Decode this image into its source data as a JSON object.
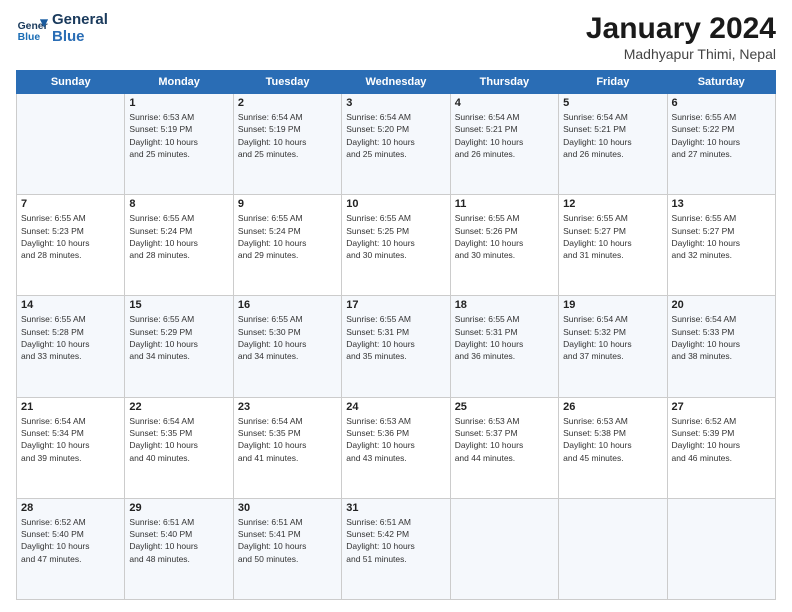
{
  "logo": {
    "line1": "General",
    "line2": "Blue"
  },
  "title": "January 2024",
  "location": "Madhyapur Thimi, Nepal",
  "days_of_week": [
    "Sunday",
    "Monday",
    "Tuesday",
    "Wednesday",
    "Thursday",
    "Friday",
    "Saturday"
  ],
  "weeks": [
    [
      {
        "num": "",
        "info": ""
      },
      {
        "num": "1",
        "info": "Sunrise: 6:53 AM\nSunset: 5:19 PM\nDaylight: 10 hours\nand 25 minutes."
      },
      {
        "num": "2",
        "info": "Sunrise: 6:54 AM\nSunset: 5:19 PM\nDaylight: 10 hours\nand 25 minutes."
      },
      {
        "num": "3",
        "info": "Sunrise: 6:54 AM\nSunset: 5:20 PM\nDaylight: 10 hours\nand 25 minutes."
      },
      {
        "num": "4",
        "info": "Sunrise: 6:54 AM\nSunset: 5:21 PM\nDaylight: 10 hours\nand 26 minutes."
      },
      {
        "num": "5",
        "info": "Sunrise: 6:54 AM\nSunset: 5:21 PM\nDaylight: 10 hours\nand 26 minutes."
      },
      {
        "num": "6",
        "info": "Sunrise: 6:55 AM\nSunset: 5:22 PM\nDaylight: 10 hours\nand 27 minutes."
      }
    ],
    [
      {
        "num": "7",
        "info": "Sunrise: 6:55 AM\nSunset: 5:23 PM\nDaylight: 10 hours\nand 28 minutes."
      },
      {
        "num": "8",
        "info": "Sunrise: 6:55 AM\nSunset: 5:24 PM\nDaylight: 10 hours\nand 28 minutes."
      },
      {
        "num": "9",
        "info": "Sunrise: 6:55 AM\nSunset: 5:24 PM\nDaylight: 10 hours\nand 29 minutes."
      },
      {
        "num": "10",
        "info": "Sunrise: 6:55 AM\nSunset: 5:25 PM\nDaylight: 10 hours\nand 30 minutes."
      },
      {
        "num": "11",
        "info": "Sunrise: 6:55 AM\nSunset: 5:26 PM\nDaylight: 10 hours\nand 30 minutes."
      },
      {
        "num": "12",
        "info": "Sunrise: 6:55 AM\nSunset: 5:27 PM\nDaylight: 10 hours\nand 31 minutes."
      },
      {
        "num": "13",
        "info": "Sunrise: 6:55 AM\nSunset: 5:27 PM\nDaylight: 10 hours\nand 32 minutes."
      }
    ],
    [
      {
        "num": "14",
        "info": "Sunrise: 6:55 AM\nSunset: 5:28 PM\nDaylight: 10 hours\nand 33 minutes."
      },
      {
        "num": "15",
        "info": "Sunrise: 6:55 AM\nSunset: 5:29 PM\nDaylight: 10 hours\nand 34 minutes."
      },
      {
        "num": "16",
        "info": "Sunrise: 6:55 AM\nSunset: 5:30 PM\nDaylight: 10 hours\nand 34 minutes."
      },
      {
        "num": "17",
        "info": "Sunrise: 6:55 AM\nSunset: 5:31 PM\nDaylight: 10 hours\nand 35 minutes."
      },
      {
        "num": "18",
        "info": "Sunrise: 6:55 AM\nSunset: 5:31 PM\nDaylight: 10 hours\nand 36 minutes."
      },
      {
        "num": "19",
        "info": "Sunrise: 6:54 AM\nSunset: 5:32 PM\nDaylight: 10 hours\nand 37 minutes."
      },
      {
        "num": "20",
        "info": "Sunrise: 6:54 AM\nSunset: 5:33 PM\nDaylight: 10 hours\nand 38 minutes."
      }
    ],
    [
      {
        "num": "21",
        "info": "Sunrise: 6:54 AM\nSunset: 5:34 PM\nDaylight: 10 hours\nand 39 minutes."
      },
      {
        "num": "22",
        "info": "Sunrise: 6:54 AM\nSunset: 5:35 PM\nDaylight: 10 hours\nand 40 minutes."
      },
      {
        "num": "23",
        "info": "Sunrise: 6:54 AM\nSunset: 5:35 PM\nDaylight: 10 hours\nand 41 minutes."
      },
      {
        "num": "24",
        "info": "Sunrise: 6:53 AM\nSunset: 5:36 PM\nDaylight: 10 hours\nand 43 minutes."
      },
      {
        "num": "25",
        "info": "Sunrise: 6:53 AM\nSunset: 5:37 PM\nDaylight: 10 hours\nand 44 minutes."
      },
      {
        "num": "26",
        "info": "Sunrise: 6:53 AM\nSunset: 5:38 PM\nDaylight: 10 hours\nand 45 minutes."
      },
      {
        "num": "27",
        "info": "Sunrise: 6:52 AM\nSunset: 5:39 PM\nDaylight: 10 hours\nand 46 minutes."
      }
    ],
    [
      {
        "num": "28",
        "info": "Sunrise: 6:52 AM\nSunset: 5:40 PM\nDaylight: 10 hours\nand 47 minutes."
      },
      {
        "num": "29",
        "info": "Sunrise: 6:51 AM\nSunset: 5:40 PM\nDaylight: 10 hours\nand 48 minutes."
      },
      {
        "num": "30",
        "info": "Sunrise: 6:51 AM\nSunset: 5:41 PM\nDaylight: 10 hours\nand 50 minutes."
      },
      {
        "num": "31",
        "info": "Sunrise: 6:51 AM\nSunset: 5:42 PM\nDaylight: 10 hours\nand 51 minutes."
      },
      {
        "num": "",
        "info": ""
      },
      {
        "num": "",
        "info": ""
      },
      {
        "num": "",
        "info": ""
      }
    ]
  ]
}
